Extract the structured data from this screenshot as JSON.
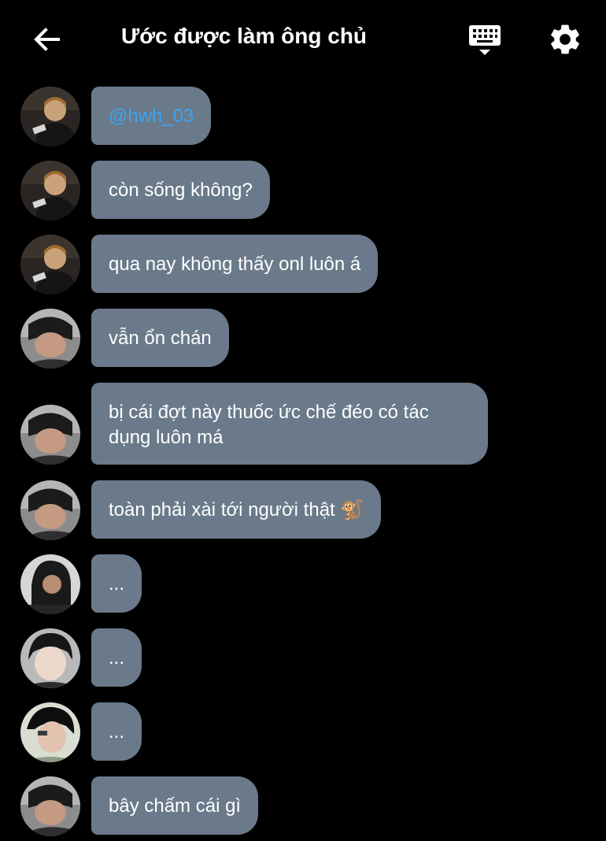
{
  "header": {
    "title": "Ước được làm ông chủ"
  },
  "colors": {
    "background": "#000000",
    "bubble": "#6a7a8a",
    "mention": "#3aa6ee",
    "text": "#ffffff"
  },
  "messages": [
    {
      "avatar": "user-a",
      "text": "@hwh_03"
    },
    {
      "avatar": "user-a",
      "text": "còn sống không?"
    },
    {
      "avatar": "user-a",
      "text": "qua nay không thấy onl luôn á"
    },
    {
      "avatar": "user-b",
      "text": "vẫn ổn chán"
    },
    {
      "avatar": "user-b",
      "text": "bị cái đợt này thuốc ức chế đéo có tác dụng luôn má"
    },
    {
      "avatar": "user-b",
      "text": "toàn phải xài tới người thật 🐒"
    },
    {
      "avatar": "user-c",
      "text": "..."
    },
    {
      "avatar": "user-d",
      "text": "..."
    },
    {
      "avatar": "user-e",
      "text": "..."
    },
    {
      "avatar": "user-b",
      "text": "bây chấm cái gì"
    }
  ]
}
